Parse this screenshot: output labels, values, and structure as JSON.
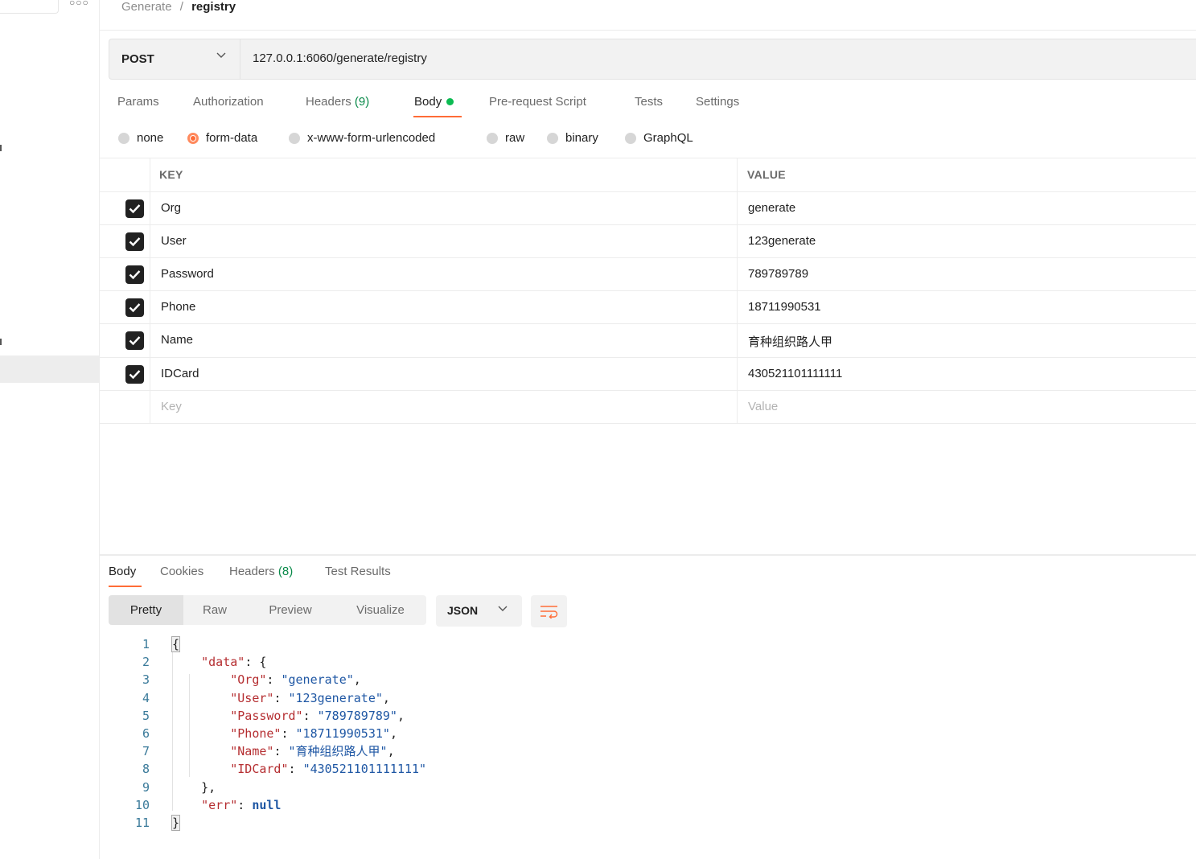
{
  "breadcrumb": {
    "parent": "Generate",
    "separator": "/",
    "current": "registry"
  },
  "request": {
    "method": "POST",
    "url": "127.0.0.1:6060/generate/registry"
  },
  "request_tabs": {
    "params": "Params",
    "authorization": "Authorization",
    "headers": "Headers",
    "headers_count": "(9)",
    "body": "Body",
    "prerequest": "Pre-request Script",
    "tests": "Tests",
    "settings": "Settings",
    "active": "Body"
  },
  "body_types": {
    "none": "none",
    "form_data": "form-data",
    "urlencoded": "x-www-form-urlencoded",
    "raw": "raw",
    "binary": "binary",
    "graphql": "GraphQL",
    "selected": "form-data"
  },
  "form_table": {
    "key_header": "KEY",
    "value_header": "VALUE",
    "rows": [
      {
        "key": "Org",
        "value": "generate",
        "checked": true
      },
      {
        "key": "User",
        "value": "123generate",
        "checked": true
      },
      {
        "key": "Password",
        "value": "789789789",
        "checked": true
      },
      {
        "key": "Phone",
        "value": "18711990531",
        "checked": true
      },
      {
        "key": "Name",
        "value": "育种组织路人甲",
        "checked": true
      },
      {
        "key": "IDCard",
        "value": "430521101111111",
        "checked": true
      }
    ],
    "key_placeholder": "Key",
    "value_placeholder": "Value"
  },
  "response_tabs": {
    "body": "Body",
    "cookies": "Cookies",
    "headers": "Headers",
    "headers_count": "(8)",
    "test_results": "Test Results",
    "active": "Body"
  },
  "response_format": {
    "pretty": "Pretty",
    "raw": "Raw",
    "preview": "Preview",
    "visualize": "Visualize",
    "active": "Pretty",
    "language": "JSON"
  },
  "response_body": {
    "line_numbers": [
      "1",
      "2",
      "3",
      "4",
      "5",
      "6",
      "7",
      "8",
      "9",
      "10",
      "11"
    ],
    "open_brace": "{",
    "data_key": "\"data\"",
    "org_key": "\"Org\"",
    "org_val": "\"generate\"",
    "user_key": "\"User\"",
    "user_val": "\"123generate\"",
    "password_key": "\"Password\"",
    "password_val": "\"789789789\"",
    "phone_key": "\"Phone\"",
    "phone_val": "\"18711990531\"",
    "name_key": "\"Name\"",
    "name_val": "\"育种组织路人甲\"",
    "idcard_key": "\"IDCard\"",
    "idcard_val": "\"430521101111111\"",
    "close_data": "},",
    "err_key": "\"err\"",
    "err_val": "null",
    "close_brace": "}"
  },
  "colors": {
    "accent": "#ff6c37",
    "success": "#0cbb52",
    "json_key": "#b52e31",
    "json_string": "#1f57a4"
  },
  "icons": {
    "more": "more-icon",
    "chevron": "chevron-down-icon",
    "checkbox": "checkbox-checked-icon",
    "wrap": "wrap-lines-icon"
  }
}
